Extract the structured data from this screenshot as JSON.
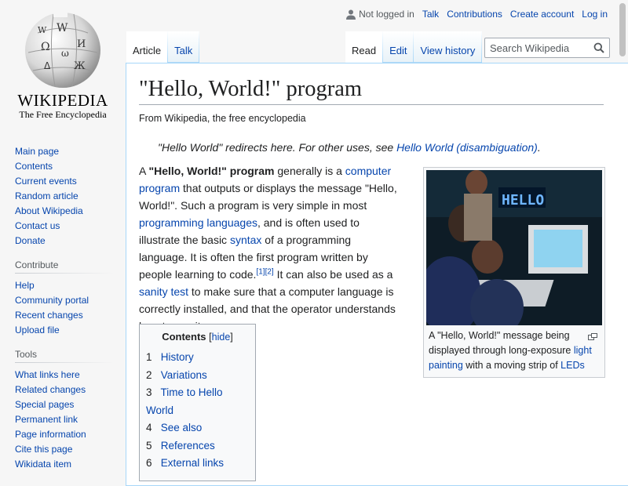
{
  "logo": {
    "wordmark": "WIKIPEDIA",
    "tagline": "The Free Encyclopedia"
  },
  "sidebar": {
    "navigation": [
      "Main page",
      "Contents",
      "Current events",
      "Random article",
      "About Wikipedia",
      "Contact us",
      "Donate"
    ],
    "contribute": {
      "heading": "Contribute",
      "items": [
        "Help",
        "Community portal",
        "Recent changes",
        "Upload file"
      ]
    },
    "tools": {
      "heading": "Tools",
      "items": [
        "What links here",
        "Related changes",
        "Special pages",
        "Permanent link",
        "Page information",
        "Cite this page",
        "Wikidata item"
      ]
    }
  },
  "personal": {
    "status": "Not logged in",
    "talk": "Talk",
    "contributions": "Contributions",
    "create_account": "Create account",
    "login": "Log in"
  },
  "tabs": {
    "article": "Article",
    "talk": "Talk",
    "read": "Read",
    "edit": "Edit",
    "history": "View history"
  },
  "search": {
    "placeholder": "Search Wikipedia"
  },
  "article": {
    "title": "\"Hello, World!\" program",
    "site_sub": "From Wikipedia, the free encyclopedia",
    "hatnote_text": "\"Hello World\" redirects here. For other uses, see ",
    "hatnote_link": "Hello World (disambiguation)",
    "hatnote_end": ".",
    "intro": {
      "t1": "A ",
      "bold": "\"Hello, World!\" program",
      "t2": " generally is a ",
      "link1": "computer program",
      "t3": " that outputs or displays the message \"Hello, World!\". Such a program is very simple in most ",
      "link2": "programming languages",
      "t4": ", and is often used to illustrate the basic ",
      "link3": "syntax",
      "t5": " of a programming language. It is often the first program written by people learning to code.",
      "ref1": "[1]",
      "ref2": "[2]",
      "t6": " It can also be used as a ",
      "link4": "sanity test",
      "t7": " to make sure that a computer language is correctly installed, and that the operator understands how to use it."
    },
    "thumb": {
      "c1": "A \"Hello, World!\" message being displayed through long-exposure ",
      "link1": "light painting",
      "c2": " with a moving strip of ",
      "link2": "LEDs",
      "led_text": "HELLO"
    }
  },
  "toc": {
    "title": "Contents",
    "hide_open": "[",
    "hide": "hide",
    "hide_close": "]",
    "items": [
      {
        "num": "1",
        "label": "History"
      },
      {
        "num": "2",
        "label": "Variations"
      },
      {
        "num": "3",
        "label": "Time to Hello World"
      },
      {
        "num": "4",
        "label": "See also"
      },
      {
        "num": "5",
        "label": "References"
      },
      {
        "num": "6",
        "label": "External links"
      }
    ]
  },
  "colors": {
    "link": "#0645ad",
    "text": "#202122",
    "sidebar_bg": "#f6f6f6",
    "border": "#a7d7f9"
  }
}
